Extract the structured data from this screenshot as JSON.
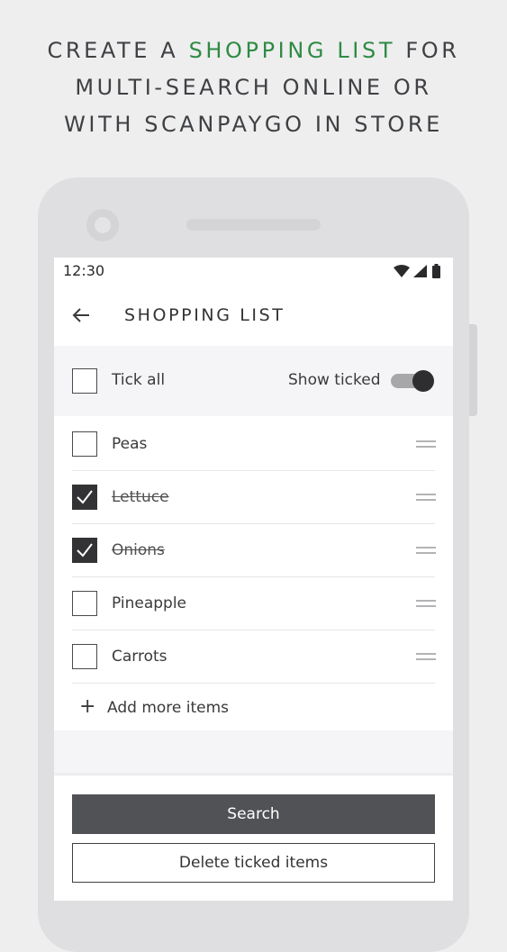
{
  "headline": {
    "line1_before": "CREATE A ",
    "line1_accent": "SHOPPING LIST",
    "line1_after": " FOR",
    "line2": "MULTI-SEARCH ONLINE OR",
    "line3": "WITH SCANPAYGO IN STORE",
    "accent_color": "#2e8b43"
  },
  "status_bar": {
    "time": "12:30",
    "icons": [
      "wifi-icon",
      "signal-icon",
      "battery-icon"
    ]
  },
  "app_bar": {
    "back_icon": "arrow-left-icon",
    "title": "SHOPPING LIST"
  },
  "controls": {
    "tick_all_label": "Tick all",
    "tick_all_checked": false,
    "show_ticked_label": "Show ticked",
    "show_ticked_on": true
  },
  "items": [
    {
      "label": "Peas",
      "checked": false
    },
    {
      "label": "Lettuce",
      "checked": true
    },
    {
      "label": "Onions",
      "checked": true
    },
    {
      "label": "Pineapple",
      "checked": false
    },
    {
      "label": "Carrots",
      "checked": false
    }
  ],
  "add_more": {
    "icon": "plus-icon",
    "label": "Add more items"
  },
  "footer": {
    "search_label": "Search",
    "delete_label": "Delete ticked items"
  }
}
